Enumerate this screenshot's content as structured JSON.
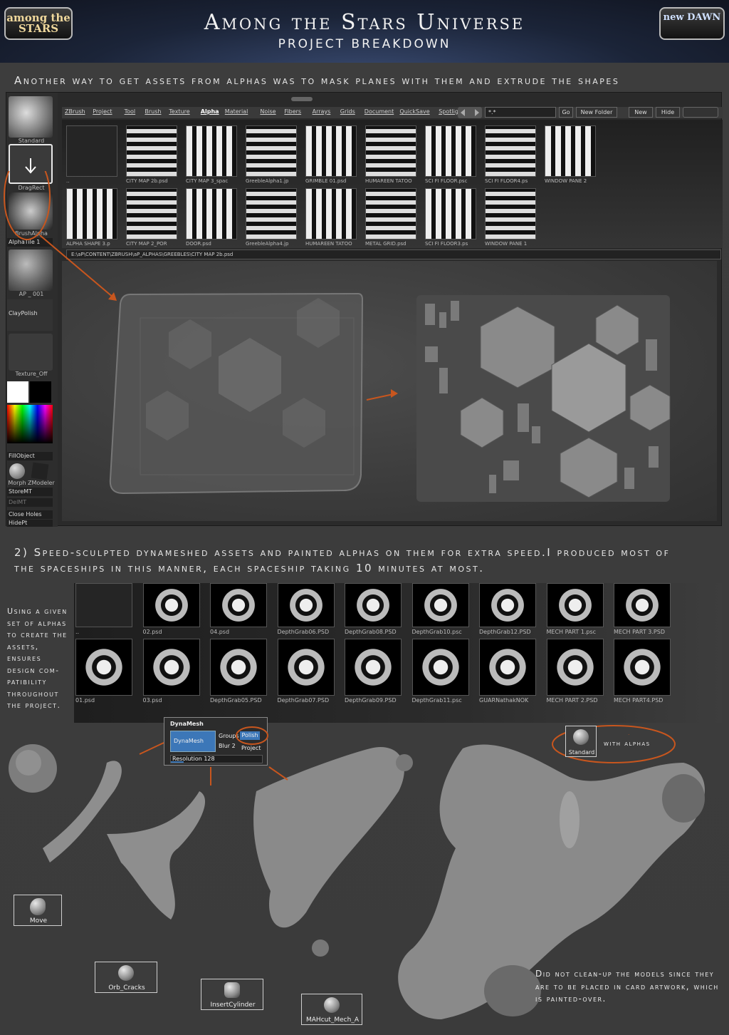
{
  "header": {
    "logo_left": "among the STARS",
    "logo_right": "new DAWN",
    "title": "Among the Stars Universe",
    "subtitle": "project breakdown"
  },
  "section1": {
    "caption": "Another way to get assets from alphas was to mask planes with them and extrude the shapes"
  },
  "left_tray": {
    "brush_label": "Standard",
    "stroke_label": "DragRect",
    "alpha_label": "BrushAlpha",
    "alpha_tile_label": "AlphaTile 1",
    "material_label": "AP _ 001",
    "clay_polish_label": "ClayPolish",
    "texture_label": "Texture_Off",
    "fill_object_label": "FillObject",
    "morph_label": "Morph",
    "zmodeler_label": "ZModeler",
    "store_mt_label": "StoreMT",
    "del_mt_label": "DelMT",
    "close_holes_label": "Close Holes",
    "hide_pt_label": "HidePt"
  },
  "menu": {
    "items": [
      "ZBrush",
      "Project",
      "Tool",
      "Brush",
      "Texture",
      "Alpha",
      "Material",
      "Noise",
      "Fibers",
      "Arrays",
      "Grids",
      "Document",
      "QuickSave",
      "Spotlight"
    ],
    "active_item": "Alpha",
    "search_value": "*.*",
    "go_label": "Go",
    "new_folder_label": "New Folder",
    "new_label": "New",
    "hide_label": "Hide"
  },
  "alpha_grid": {
    "row1": [
      "..",
      "CITY MAP 2b.psd",
      "CITY MAP 3_spac",
      "GreebleAlpha1.jp",
      "GRIMBLE 01.psd",
      "HUMAREEN TATOO",
      "SCI FI FLOOR.psc",
      "SCI FI FLOOR4.ps",
      "WINDOW PANE 2"
    ],
    "row2": [
      "ALPHA SHAPE 3.p",
      "CITY MAP 2_POR",
      "DOOR.psd",
      "GreebleAlpha4.jp",
      "HUMAREEN TATOO",
      "METAL GRID.psd",
      "SCI FI FLOOR3.ps",
      "WINDOW PANE 1"
    ],
    "path": "E:\\aP\\CONTENT\\ZBRUSH\\aP_ALPHAS\\GREEBLES\\CITY MAP 2b.psd"
  },
  "section2": {
    "caption_line1": "2) Speed-sculpted dynameshed assets and painted alphas on them for extra speed.I produced most of",
    "caption_line2": "the spaceships in this manner, each spaceship taking 10 minutes at most.",
    "side_note": "Using a given set of alphas to create the assets, ensures design com-patibility throughout the project.",
    "bottom_note": "Did not clean-up the models since they are to be placed in card artwork, which is painted-over.",
    "with_alphas": "with alphas"
  },
  "alpha_grid2": {
    "row1": [
      "..",
      "02.psd",
      "04.psd",
      "DepthGrab06.PSD",
      "DepthGrab08.PSD",
      "DepthGrab10.psc",
      "DepthGrab12.PSD",
      "MECH PART 1.psc",
      "MECH PART 3.PSD"
    ],
    "row2": [
      "01.psd",
      "03.psd",
      "DepthGrab05.PSD",
      "DepthGrab07.PSD",
      "DepthGrab09.PSD",
      "DepthGrab11.psc",
      "GUARNathakNOK",
      "MECH PART 2.PSD",
      "MECH PART4.PSD"
    ]
  },
  "dynamesh": {
    "title": "DynaMesh",
    "button": "DynaMesh",
    "groups": "Groups",
    "polish": "Polish",
    "blur": "Blur 2",
    "project": "Project",
    "resolution": "Resolution 128"
  },
  "brushes": {
    "standard": "Standard",
    "move": "Move",
    "orb_cracks": "Orb_Cracks",
    "insert_cylinder": "InsertCylinder",
    "mahcut": "MAHcut_Mech_A"
  },
  "colors": {
    "accent_orange": "#c8561e",
    "button_blue": "#3c77b8"
  }
}
